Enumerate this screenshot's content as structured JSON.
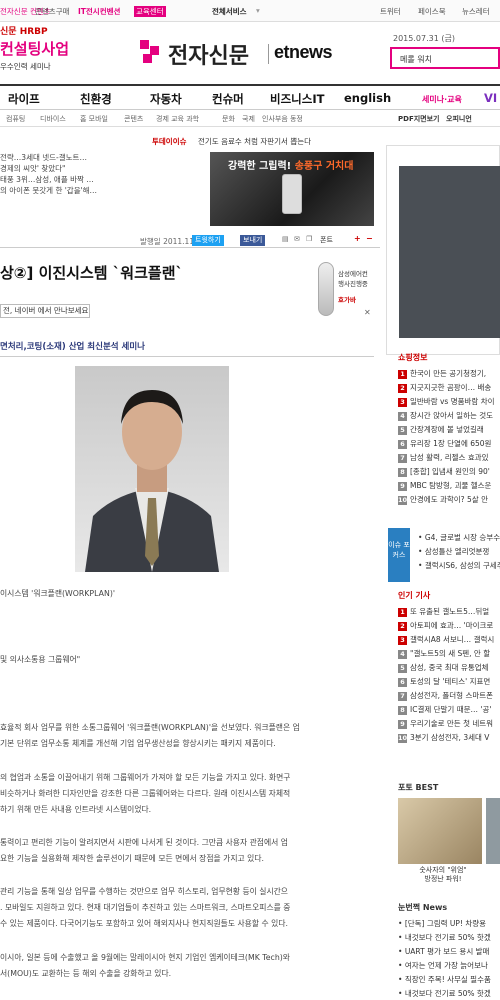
{
  "topbar": {
    "left_items": [
      "전자신문 컨텐츠",
      "콘텐츠구매",
      "IT전시컨벤션",
      "교육센터"
    ],
    "service": "전체서비스",
    "social": [
      "트위터",
      "페이스북",
      "뉴스레터"
    ]
  },
  "header_promo": {
    "line1": "신문 HRBP",
    "line2": "컨설팅사업",
    "line3": "우수인력 세미나"
  },
  "logo": {
    "ko": "전자신문",
    "en": "etnews"
  },
  "date": "2015.07.31 (금)",
  "search": {
    "value": "메롤 워치"
  },
  "nav": [
    "라이프",
    "친환경",
    "자동차",
    "컨슈머",
    "비즈니스IT",
    "english",
    "세미나·교육",
    "VI"
  ],
  "subnav": [
    "컴퓨팅",
    "디바이스",
    "홈 모바일",
    "콘텐츠",
    "경제 교육 과학",
    "문화",
    "국제",
    "인사부음 동정",
    "PDF지면보기",
    "오피니언"
  ],
  "today": {
    "label": "투데이이슈",
    "text": "전기도 음료수 처럼 자판기서 뽑는다"
  },
  "breaking": [
    "전략…3세대 넷드-갤노트…",
    "경제의 씨앗' 찾았다\"",
    "태풍 3위…삼성, 애플 바짝 …",
    "의 아이폰 뭇갓게 한 '갑을'해…"
  ],
  "ad_car": {
    "text_a": "강력한 그립력!",
    "text_b": "송풍구 거치대"
  },
  "meta": {
    "date": "발행일 2011.11.14",
    "tweet": "트윗하기",
    "fb": "보내기",
    "font": "폰트"
  },
  "headline": "상②] 이진시스템 `워크플랜`",
  "samsung_ad": {
    "line1": "삼성에어컨",
    "line2": "행사진행중",
    "line3": "호가바"
  },
  "naver_btn": "전, 네이버 에서 만나보세요",
  "related": "면처리,코팅(소재) 산업 최신분석 세미나",
  "body": [
    "이시스템 '워크플랜(WORKPLAN)'",
    "및 의사소통용 그룹웨어\"",
    "효율적 회사 업무를 위한 소통그룹웨어 '워크플랜(WORKPLAN)'을 선보였다. 워크플랜은 업",
    "기본 단위로 업무소통 체계를 개선해 기업 업무생산성을 향상시키는 패키지 제품이다.",
    "의 협업과 소통을 이끌어내기 위해 그룹웨어가 가져야 할 모든 기능을 가지고 있다. 화면구",
    "비슷하거나 화려한 디자인만을 강조한 다른 그룹웨어와는 다르다. 원래 이진시스템 자체적",
    "하기 위해 만든 사내용 인트라넷 시스템이었다.",
    "통력이고 편리한 기능이 알려지면서 시판에 나서게 된 것이다. 그만큼 사용자 관점에서 업",
    "요한 기능을 실용화해 제작한 솔루션이기 때문에 모든 면에서 장점을 가지고 있다.",
    "관리 기능을 통해 일상 업무를 수행하는 것만으로 업무 히스토리, 업무현황 등이 실시간으",
    ". 모바일도 지원하고 있다. 현재 대기업들이 추진하고 있는 스마트워크, 스마트오피스를 중",
    "수 있는 제품이다. 다국어기능도 포함하고 있어 해외지사나 현지직원들도 사용할 수 있다.",
    "이시아, 일본 등에 수출했고 올 9월에는 말레이시아 현지 기업인 엠케이테크(MK Tech)와",
    "서(MOU)도 교환하는 등 해외 수출을 강화하고 있다."
  ],
  "rail": {
    "shopping_title": "쇼핑정보",
    "shopping": [
      "한국이 만든 공기청정기,",
      "지긋지긋한 곰팡이… 배송",
      "일반바람 vs 명품바람 차이",
      "장시간 앉아서 일하는 것도",
      "간장계장에 볼 넣었길래",
      "유리장 1장 단열에 650원",
      "남성 활력, 리젤스 효과있",
      "[종합] 입냄새 원인의 90'",
      "MBC 탐방형, 괴물 헬스운",
      "안경에도 과학이? 5살 안"
    ],
    "issue_label": "이슈 포커스",
    "issue": [
      "G4, 글로벌 시장 승부수",
      "삼성틀산 엘리엇분쟁",
      "갤럭시S6, 삼성의 구세주"
    ],
    "popular_title": "인기 기사",
    "popular": [
      "또 유출된 갤노트5…뒤얼",
      "아토피에 효과… '마이크로",
      "갤럭시A8 서보니… 갤럭시",
      "\"갤노트5의 새 S펜, 안 할",
      "삼성, 중국 최대 유통업체",
      "토성의 달 '테티스' 지표면",
      "삼성전자, 폴더형 스마트폰",
      "IC결제 단말기 때문… '공'",
      "우리기술로 만든 첫 네트워",
      "3분기 삼성전자, 3세대 V"
    ],
    "photo_title": "포토 BEST",
    "photo_caption": "숫사자의 \"위엄\"\n방정난 파워!",
    "news_title": "눈번쩍 News",
    "news": [
      "[단독] 그림력 UP! 차량용",
      "내것보다 전기료 50% 핫겠",
      "UART 평가 보드 용시 발매",
      "여자는 언제 가장 늙어보나",
      "직장인 주목! 사무실 필수품",
      "내것보다 전기료 50% 핫겠"
    ]
  }
}
